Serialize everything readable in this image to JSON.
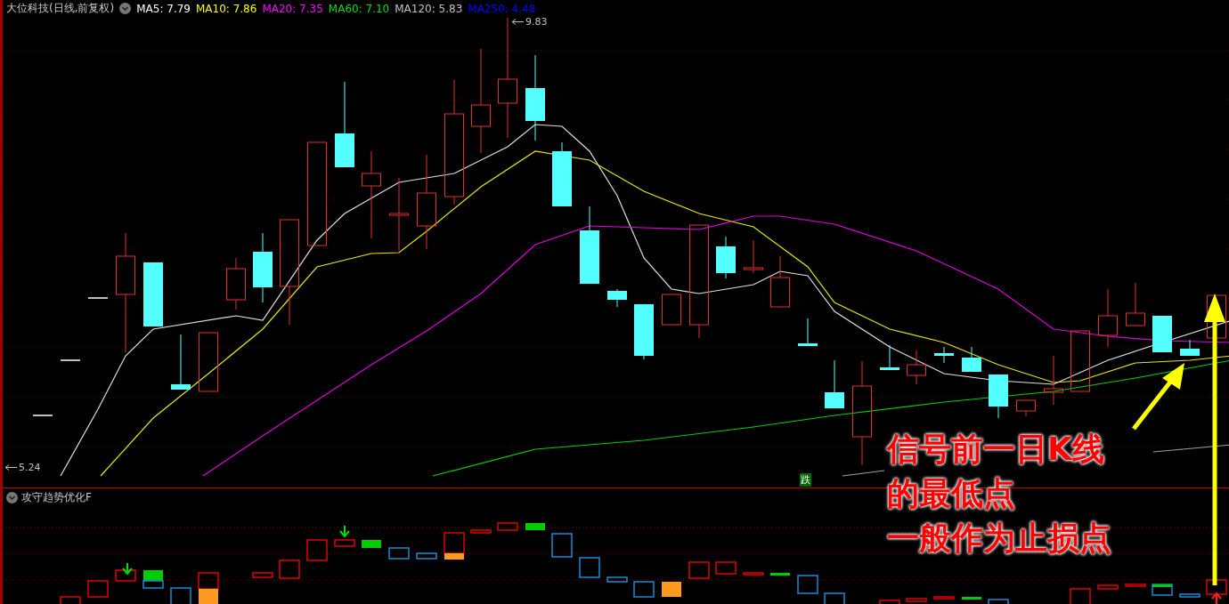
{
  "chart_header": {
    "title": "大位科技(日线,前复权)",
    "legend": [
      {
        "label": "MA5: 7.79",
        "color": "#ffffff"
      },
      {
        "label": "MA10: 7.86",
        "color": "#ffff00"
      },
      {
        "label": "MA20: 7.35",
        "color": "#ff00ff"
      },
      {
        "label": "MA60: 7.10",
        "color": "#00e000"
      },
      {
        "label": "MA120: 5.83",
        "color": "#c0c0c0"
      },
      {
        "label": "MA250: 4.48",
        "color": "#0000ff"
      }
    ]
  },
  "price_marks": {
    "high": "9.83",
    "low": "5.24"
  },
  "signals": [
    {
      "label": "跌",
      "kind": "sell"
    }
  ],
  "indicator": {
    "title": "攻守趋势优化F"
  },
  "annotation": {
    "lines": [
      "信号前一日K线",
      "的最低点",
      "一般作为止损点"
    ]
  }
}
